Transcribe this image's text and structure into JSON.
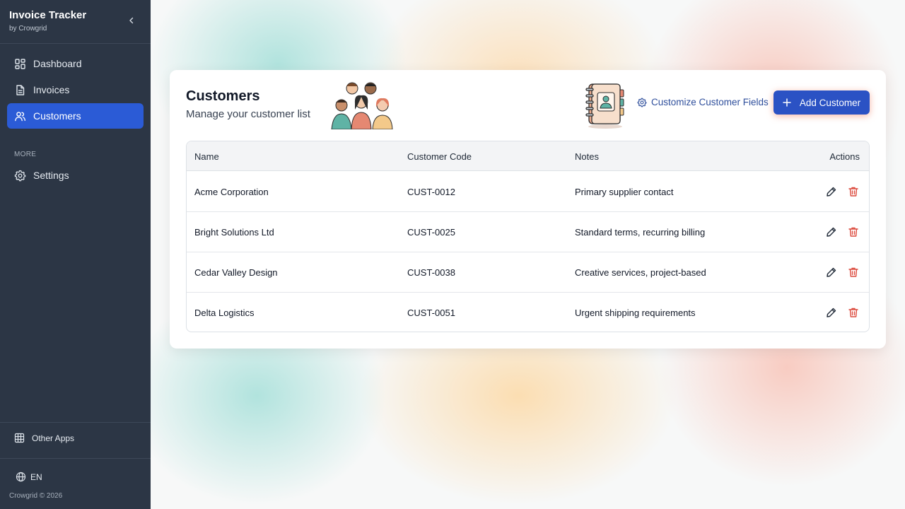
{
  "sidebar": {
    "title": "Invoice Tracker",
    "subtitle": "by Crowgrid",
    "nav": [
      {
        "label": "Dashboard",
        "icon": "dashboard-icon"
      },
      {
        "label": "Invoices",
        "icon": "document-icon"
      },
      {
        "label": "Customers",
        "icon": "users-icon",
        "active": true
      }
    ],
    "more_label": "MORE",
    "settings_label": "Settings",
    "other_apps_label": "Other Apps",
    "language": "EN",
    "copyright": "Crowgrid © 2026"
  },
  "header": {
    "title": "Customers",
    "subtitle": "Manage your customer list",
    "customize_label": "Customize Customer Fields",
    "add_label": "Add Customer"
  },
  "table": {
    "columns": [
      "Name",
      "Customer Code",
      "Notes",
      "Actions"
    ],
    "rows": [
      {
        "name": "Acme Corporation",
        "code": "CUST-0012",
        "notes": "Primary supplier contact"
      },
      {
        "name": "Bright Solutions Ltd",
        "code": "CUST-0025",
        "notes": "Standard terms, recurring billing"
      },
      {
        "name": "Cedar Valley Design",
        "code": "CUST-0038",
        "notes": "Creative services, project-based"
      },
      {
        "name": "Delta Logistics",
        "code": "CUST-0051",
        "notes": "Urgent shipping requirements"
      }
    ]
  },
  "colors": {
    "sidebar_bg": "#2c3645",
    "active_nav": "#2b5bd6",
    "primary_button": "#2b52c4",
    "link": "#2f4f9c",
    "delete_icon": "#dc4a3d"
  }
}
